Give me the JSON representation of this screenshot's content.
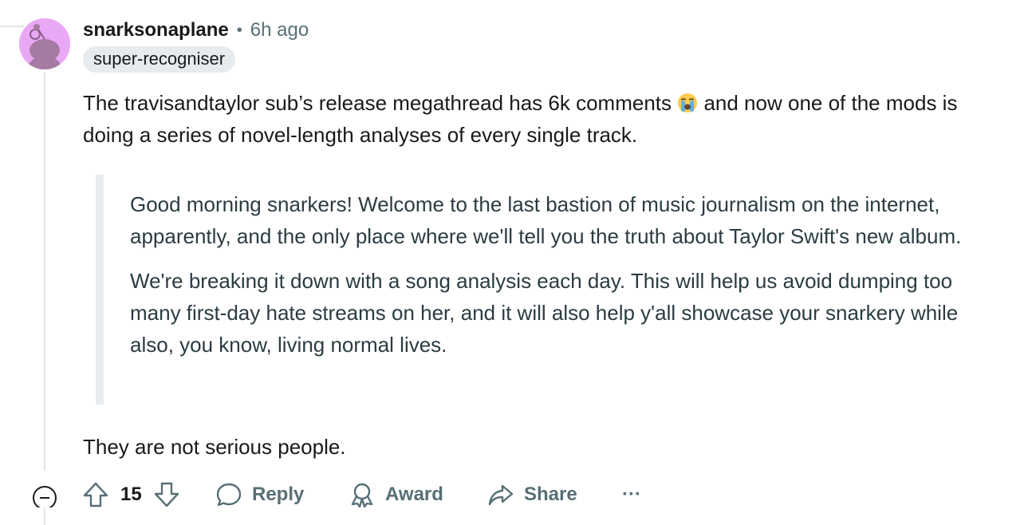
{
  "comment": {
    "username": "snarksonaplane",
    "separator": "•",
    "time": "6h ago",
    "flair": "super-recogniser",
    "body_before_emoji": "The travisandtaylor sub’s release megathread has 6k comments ",
    "emoji": "loudly-crying-face",
    "body_after_emoji": " and now one of the mods is doing a series of novel-length analyses of every single track.",
    "quote_paragraphs": [
      "Good morning snarkers! Welcome to the last bastion of music journalism on the internet, apparently, and the only place where we'll tell you the truth about Taylor Swift's new album.",
      "We're breaking it down with a song analysis each day. This will help us avoid dumping too many first-day hate streams on her, and it will also help y'all showcase your snarkery while also, you know, living normal lives."
    ],
    "closing": "They are not serious people."
  },
  "actions": {
    "collapse_icon": "collapse-minus-icon",
    "upvote_icon": "upvote-arrow-icon",
    "score": "15",
    "downvote_icon": "downvote-arrow-icon",
    "reply_label": "Reply",
    "award_label": "Award",
    "share_label": "Share",
    "more_label": "···"
  },
  "colors": {
    "avatar_bg": "#e9a8f4",
    "meta_gray": "#576f76",
    "flair_bg": "#e5ebee",
    "quote_bar": "#e9ecee"
  }
}
